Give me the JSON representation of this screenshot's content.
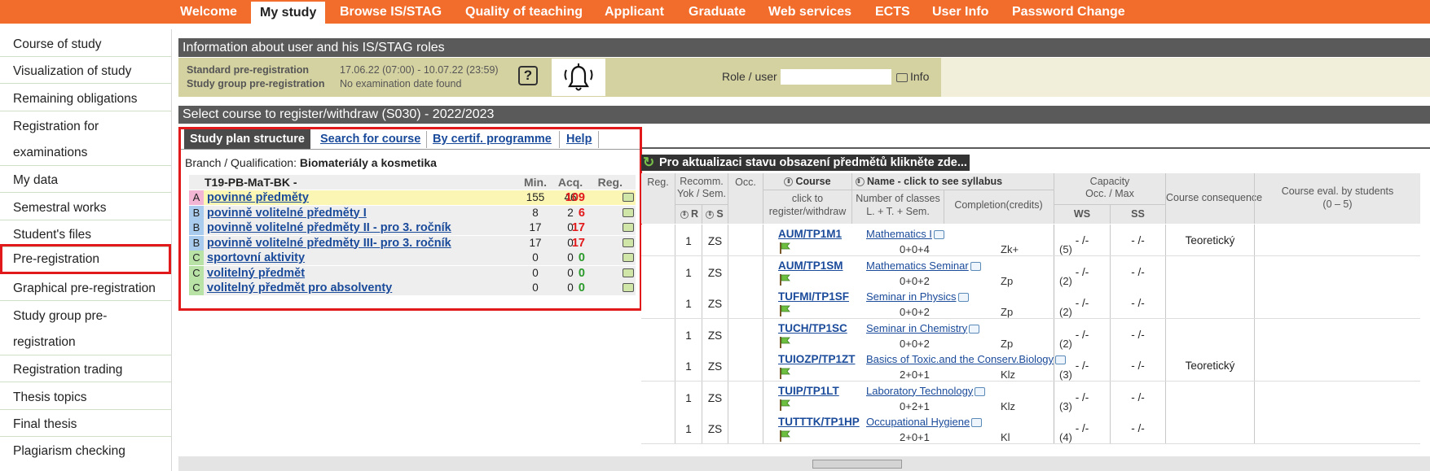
{
  "nav": {
    "items": [
      "Welcome",
      "My study",
      "Browse IS/STAG",
      "Quality of teaching",
      "Applicant",
      "Graduate",
      "Web services",
      "ECTS",
      "User Info",
      "Password Change"
    ],
    "active": "My study"
  },
  "sidebar": {
    "items": [
      "Course of study",
      "Visualization of study",
      "Remaining obligations",
      "Registration for examinations",
      "My data",
      "Semestral works",
      "Student's files",
      "Pre-registration",
      "Graphical pre-registration",
      "Study group pre-registration",
      "Registration trading",
      "Thesis topics",
      "Final thesis",
      "Plagiarism checking"
    ],
    "selected": "Pre-registration"
  },
  "info_bar": {
    "title": "Information about user and his IS/STAG roles"
  },
  "prereg": {
    "standard_label": "Standard pre-registration",
    "standard_value": "17.06.22 (07:00) - 10.07.22 (23:59)",
    "group_label": "Study group pre-registration",
    "group_value": "No examination date found",
    "help": "?",
    "role_label": "Role / user",
    "role_value": "",
    "info_label": "Info"
  },
  "select_bar": {
    "title": "Select course to register/withdraw (S030) - 2022/2023"
  },
  "subtabs": [
    "Study plan structure",
    "Search for course",
    "By certif. programme",
    "Help"
  ],
  "branch": {
    "label": "Branch / Qualification:",
    "value": "Biomateriály a kosmetika"
  },
  "study_plan": {
    "code": "T19-PB-MaT-BK -",
    "headers": {
      "min": "Min.",
      "acq": "Acq.",
      "reg": "Reg."
    },
    "rows": [
      {
        "cat": "A",
        "name": "povinné předměty",
        "min": "155",
        "acq": "46",
        "reg": "109"
      },
      {
        "cat": "B",
        "name": "povinně volitelné předměty I",
        "min": "8",
        "acq": "2",
        "reg": "6"
      },
      {
        "cat": "B",
        "name": "povinně volitelné předměty II - pro 3. ročník",
        "min": "17",
        "acq": "0",
        "reg": "17"
      },
      {
        "cat": "B",
        "name": "povinně volitelné předměty III- pro 3. ročník",
        "min": "17",
        "acq": "0",
        "reg": "17"
      },
      {
        "cat": "C",
        "name": "sportovní aktivity",
        "min": "0",
        "acq": "0",
        "reg": "0"
      },
      {
        "cat": "C",
        "name": "volitelný předmět",
        "min": "0",
        "acq": "0",
        "reg": "0"
      },
      {
        "cat": "C",
        "name": "volitelný předmět pro absolventy",
        "min": "0",
        "acq": "0",
        "reg": "0"
      }
    ]
  },
  "refresh": {
    "label": "Pro aktualizaci stavu obsazení předmětů klikněte zde..."
  },
  "courses_table": {
    "headers": {
      "reg": "Reg.",
      "recomm": "Recomm.",
      "yok_sem": "Yok / Sem.",
      "r": "R",
      "s": "S",
      "occ": "Occ.",
      "course": "Course",
      "course_sub": "click to register/withdraw",
      "name": "Name - click to see syllabus",
      "classes": "Number of classes L. + T. + Sem.",
      "completion": "Completion(credits)",
      "capacity": "Capacity",
      "capacity_sub": "Occ. / Max",
      "ws": "WS",
      "ss": "SS",
      "consequence": "Course consequence",
      "eval": "Course eval. by students (0 – 5)"
    },
    "rows": [
      {
        "r": "1",
        "s": "ZS",
        "code": "AUM/TP1M1",
        "name": "Mathematics I",
        "classes": "0+0+4",
        "type": "Zk+",
        "credits": "(5)",
        "ws": "- /-",
        "ss": "- /-",
        "consequence": "Teoretický"
      },
      {
        "r": "1",
        "s": "ZS",
        "code": "AUM/TP1SM",
        "name": "Mathematics Seminar",
        "classes": "0+0+2",
        "type": "Zp",
        "credits": "(2)",
        "ws": "- /-",
        "ss": "- /-",
        "consequence": ""
      },
      {
        "r": "1",
        "s": "ZS",
        "code": "TUFMI/TP1SF",
        "name": "Seminar in Physics",
        "classes": "0+0+2",
        "type": "Zp",
        "credits": "(2)",
        "ws": "- /-",
        "ss": "- /-",
        "consequence": ""
      },
      {
        "r": "1",
        "s": "ZS",
        "code": "TUCH/TP1SC",
        "name": "Seminar in Chemistry",
        "classes": "0+0+2",
        "type": "Zp",
        "credits": "(2)",
        "ws": "- /-",
        "ss": "- /-",
        "consequence": ""
      },
      {
        "r": "1",
        "s": "ZS",
        "code": "TUIOZP/TP1ZT",
        "name": "Basics of Toxic.and the Conserv.Biology",
        "classes": "2+0+1",
        "type": "Klz",
        "credits": "(3)",
        "ws": "- /-",
        "ss": "- /-",
        "consequence": "Teoretický"
      },
      {
        "r": "1",
        "s": "ZS",
        "code": "TUIP/TP1LT",
        "name": "Laboratory Technology",
        "classes": "0+2+1",
        "type": "Klz",
        "credits": "(3)",
        "ws": "- /-",
        "ss": "- /-",
        "consequence": ""
      },
      {
        "r": "1",
        "s": "ZS",
        "code": "TUTTTK/TP1HP",
        "name": "Occupational Hygiene",
        "classes": "2+0+1",
        "type": "Kl",
        "credits": "(4)",
        "ws": "- /-",
        "ss": "- /-",
        "consequence": ""
      }
    ]
  },
  "colors": {
    "nav": "#f26c2b",
    "bar": "#5a5a5a",
    "olive": "#d5d2a2",
    "highlight": "#e2191b",
    "link": "#1a4a9a"
  }
}
